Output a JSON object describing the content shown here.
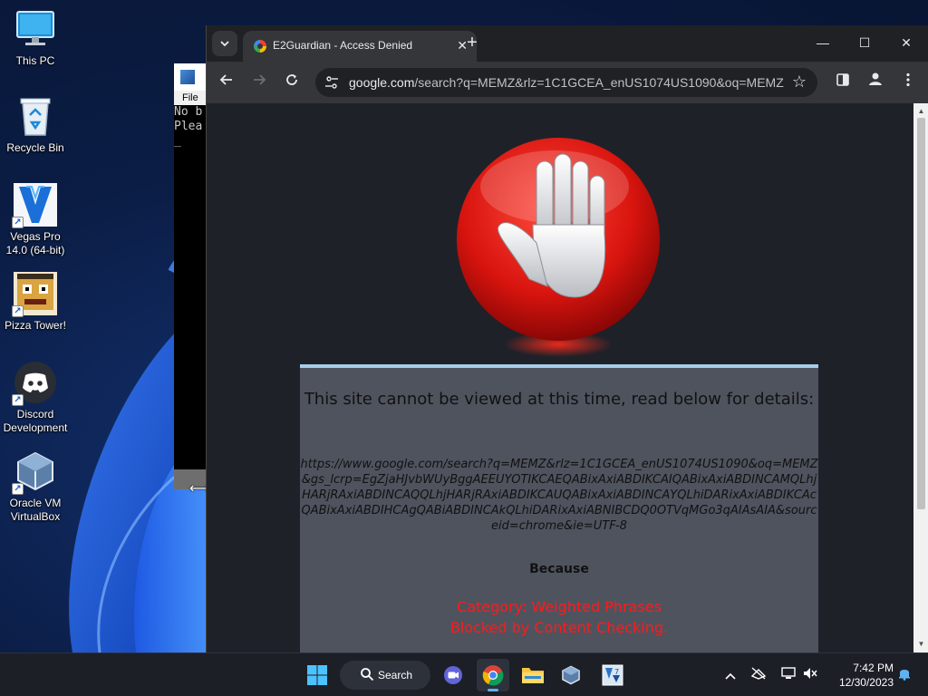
{
  "desktop": {
    "icons": [
      {
        "label": "This PC",
        "icon": "monitor-icon"
      },
      {
        "label": "Recycle Bin",
        "icon": "recycle-bin-icon"
      },
      {
        "label": "Vegas Pro\n14.0 (64-bit)",
        "icon": "vegas-pro-icon"
      },
      {
        "label": "Pizza Tower!",
        "icon": "pizza-tower-icon"
      },
      {
        "label": "Discord\nDevelopment",
        "icon": "discord-icon"
      },
      {
        "label": "Oracle VM\nVirtualBox",
        "icon": "virtualbox-icon"
      }
    ]
  },
  "console": {
    "menu_file": "File",
    "line1": "No b",
    "line2": "Plea",
    "cursor": "_"
  },
  "browser": {
    "tab_title": "E2Guardian - Access Denied",
    "tab_close": "✕",
    "new_tab": "+",
    "url_host": "google.com",
    "url_path": "/search?q=MEMZ&rlz=1C1GCEA_enUS1074US1090&oq=MEMZ...",
    "window_controls": {
      "minimize": "—",
      "maximize": "☐",
      "close": "✕"
    }
  },
  "page": {
    "headline": "This site cannot be viewed at this time, read below for details:",
    "blocked_url": "https://www.google.com/search?q=MEMZ&rlz=1C1GCEA_enUS1074US1090&oq=MEMZ&gs_lcrp=EgZjaHJvbWUyBggAEEUYOTIKCAEQABixAxiABDIKCAIQABixAxiABDINCAMQLhjHARjRAxiABDINCAQQLhjHARjRAxiABDIKCAUQABixAxiABDINCAYQLhiDARixAxiABDIKCAcQABixAxiABDIHCAgQABiABDINCAkQLhiDARixAxiABNIBCDQ0OTVqMGo3qAIAsAIA&sourceid=chrome&ie=UTF-8",
    "because": "Because",
    "reason_line1": "Category: Weighted Phrases",
    "reason_line2": "Blocked by Content Checking."
  },
  "taskbar": {
    "search_label": "Search",
    "time": "7:42 PM",
    "date": "12/30/2023"
  },
  "colors": {
    "accent": "#5fb2f2",
    "denied_text": "#ff1a1a",
    "panel": "#4f535e",
    "panel_border": "#a7cdea"
  }
}
